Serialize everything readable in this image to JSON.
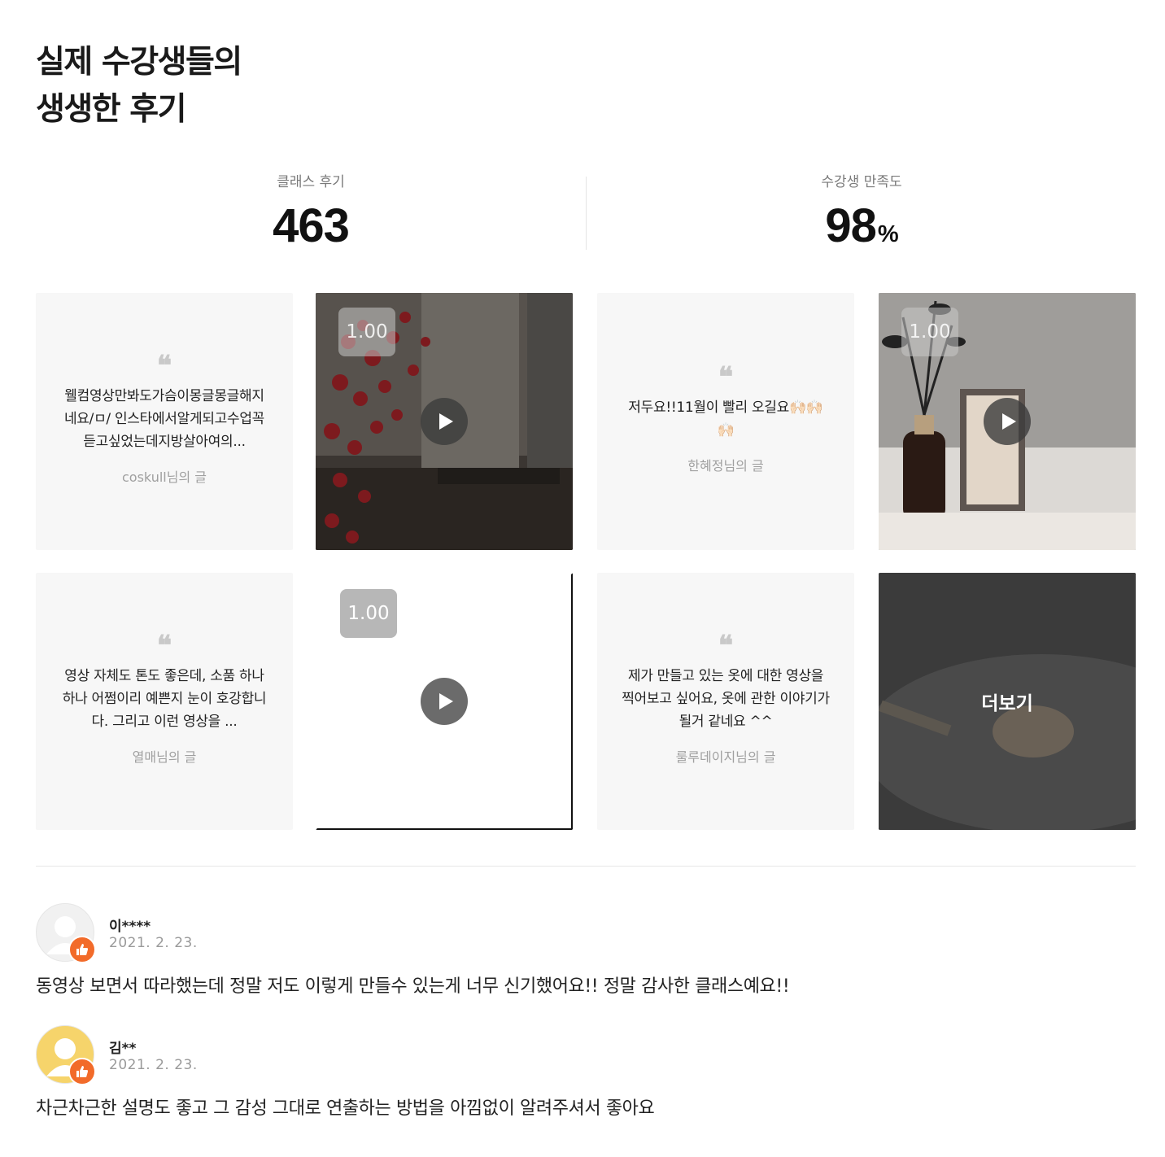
{
  "header": {
    "title_line1": "실제 수강생들의",
    "title_line2": "생생한 후기"
  },
  "stats": {
    "reviews": {
      "label": "클래스 후기",
      "value": "463",
      "unit": ""
    },
    "satisfaction": {
      "label": "수강생 만족도",
      "value": "98",
      "unit": "%"
    }
  },
  "gallery": {
    "text_reviews": [
      {
        "text": "웰컴영상만봐도가슴이몽글몽글해지네요/ㅁ/ 인스타에서알게되고수업꼭듣고싶었는데지방살아여의...",
        "author": "coskull님의 글"
      },
      {
        "text": "저두요!!11월이 빨리 오길요🙌🏻🙌🏻🙌🏻",
        "author": "한혜정님의 글"
      },
      {
        "text": "영상 자체도 톤도 좋은데, 소품 하나하나 어쩜이리 예쁜지 눈이 호강합니다. 그리고 이런 영상을 ...",
        "author": "열매님의 글"
      },
      {
        "text": "제가 만들고 있는 옷에 대한 영상을 찍어보고 싶어요, 옷에 관한 이야기가 될거 같네요 ^^",
        "author": "룰루데이지님의 글"
      }
    ],
    "videos": [
      {
        "speed": "1.00",
        "icon": "play-icon"
      },
      {
        "speed": "1.00",
        "icon": "play-icon"
      },
      {
        "speed": "1.00",
        "icon": "play-icon"
      }
    ],
    "quote_icon": "quote-icon",
    "more_label": "더보기"
  },
  "comments": [
    {
      "user": "이****",
      "date": "2021. 2. 23.",
      "text": "동영상 보면서 따라했는데 정말 저도 이렇게 만들수 있는게 너무 신기했어요!! 정말 감사한 클래스예요!!",
      "avatar_color": "#f1f1f1"
    },
    {
      "user": "김**",
      "date": "2021. 2. 23.",
      "text": "차근차근한 설명도 좋고 그 감성 그대로 연출하는 방법을 아낌없이 알려주셔서 좋아요",
      "avatar_color": "#f6d46b"
    }
  ],
  "colors": {
    "accent": "#f26b2a",
    "card_bg": "#f7f7f7"
  }
}
